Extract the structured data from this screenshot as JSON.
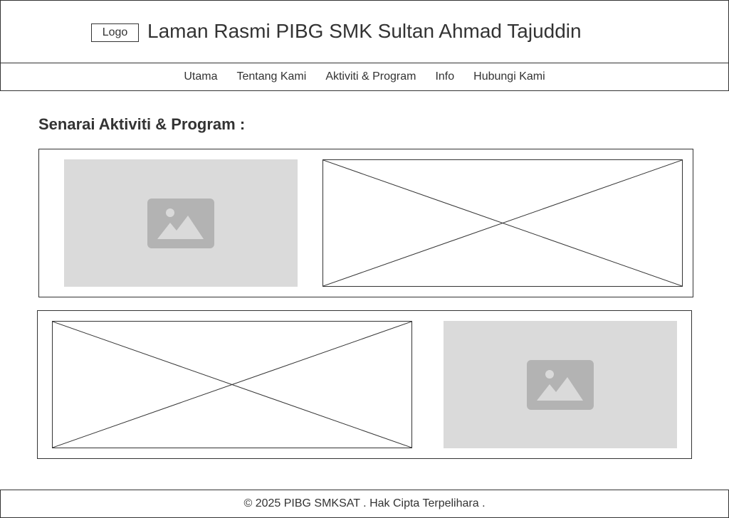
{
  "header": {
    "logo_label": "Logo",
    "title": "Laman Rasmi PIBG SMK Sultan Ahmad Tajuddin"
  },
  "nav": {
    "items": [
      {
        "label": "Utama"
      },
      {
        "label": "Tentang Kami"
      },
      {
        "label": "Aktiviti & Program"
      },
      {
        "label": "Info"
      },
      {
        "label": "Hubungi Kami"
      }
    ]
  },
  "main": {
    "heading": "Senarai Aktiviti & Program :",
    "rows": [
      {
        "left": "image-placeholder",
        "right": "x-placeholder"
      },
      {
        "left": "x-placeholder",
        "right": "image-placeholder"
      }
    ]
  },
  "footer": {
    "text": "© 2025 PIBG SMKSAT . Hak Cipta Terpelihara ."
  },
  "colors": {
    "border": "#333333",
    "placeholder_bg": "#dadada",
    "icon_fill": "#b3b3b3",
    "icon_detail": "#dadada"
  }
}
